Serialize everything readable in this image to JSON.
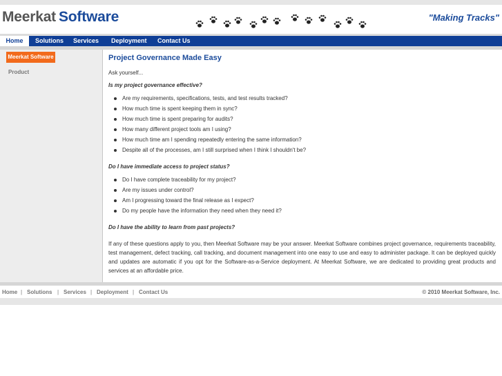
{
  "header": {
    "logo_part1": "Meerkat",
    "logo_part2": "Software",
    "slogan": "\"Making Tracks\"",
    "decoration_icon": "paw-print-icon"
  },
  "nav": {
    "items": [
      {
        "label": "Home",
        "active": true
      },
      {
        "label": "Solutions"
      },
      {
        "label": "Services"
      },
      {
        "label": "Deployment"
      },
      {
        "label": "Contact Us"
      }
    ]
  },
  "sidebar": {
    "items": [
      {
        "label": "Meerkat Software",
        "active": true
      },
      {
        "label": "Product"
      }
    ]
  },
  "content": {
    "title": "Project Governance Made Easy",
    "intro": "Ask yourself...",
    "q1": "Is my project governance effective?",
    "q1_bullets": [
      "Are my requirements, specifications, tests, and test results tracked?",
      "How much time is spent keeping them in sync?",
      "How much time is spent preparing for audits?",
      "How many different project tools am I using?",
      "How much time am I spending repeatedly entering the same information?",
      "Despite all of the processes, am I still surprised when I think I shouldn't be?"
    ],
    "q2": "Do I have immediate access to project status?",
    "q2_bullets": [
      "Do I have complete traceability for my project?",
      "Are my issues under control?",
      "Am I progressing toward the final release as I expect?",
      "Do my people have the information they need when they need it?"
    ],
    "q3": "Do I have the ability to learn from past projects?",
    "closing": "If any of these questions apply to you, then Meerkat Software may be your answer. Meerkat Software combines project governance, requirements traceability, test management, defect tracking, call tracking, and document management into one easy to use and easy to administer package. It can be deployed quickly and updates are automatic if you opt for the Software-as-a-Service deployment. At Meerkat Software, we are dedicated to providing great products and services at an affordable price."
  },
  "footer": {
    "links": [
      "Home",
      "Solutions",
      "Services",
      "Deployment",
      "Contact Us"
    ],
    "separator": "|",
    "copyright": "© 2010 Meerkat Software, Inc."
  },
  "colors": {
    "brand_blue": "#0f3e96",
    "accent_orange": "#f26a1b",
    "title_blue": "#1b4b9b"
  }
}
